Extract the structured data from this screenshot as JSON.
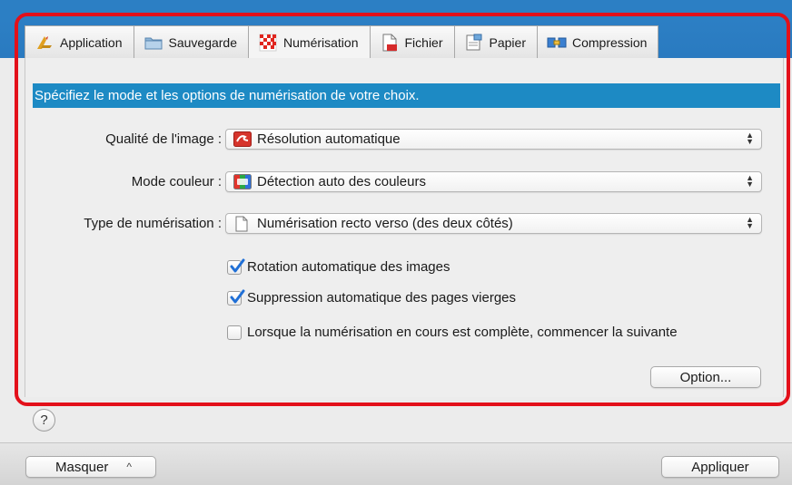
{
  "tabs": [
    {
      "label": "Application",
      "icon": "application-icon",
      "active": false
    },
    {
      "label": "Sauvegarde",
      "icon": "folder-icon",
      "active": false
    },
    {
      "label": "Numérisation",
      "icon": "scan-icon",
      "active": true
    },
    {
      "label": "Fichier",
      "icon": "file-icon",
      "active": false
    },
    {
      "label": "Papier",
      "icon": "paper-icon",
      "active": false
    },
    {
      "label": "Compression",
      "icon": "compression-icon",
      "active": false
    }
  ],
  "banner": "Spécifiez le mode et les options de numérisation de votre choix.",
  "fields": {
    "quality_label": "Qualité de l'image :",
    "quality_value": "Résolution automatique",
    "color_label": "Mode couleur :",
    "color_value": "Détection auto des couleurs",
    "scan_type_label": "Type de numérisation :",
    "scan_type_value": "Numérisation recto verso (des deux côtés)"
  },
  "checkboxes": [
    {
      "label": "Rotation automatique des images",
      "checked": true
    },
    {
      "label": "Suppression automatique des pages vierges",
      "checked": true
    },
    {
      "label": "Lorsque la numérisation en cours est complète, commencer la suivante",
      "checked": false
    }
  ],
  "buttons": {
    "option": "Option...",
    "hide": "Masquer",
    "hide_chevron": "^",
    "apply": "Appliquer",
    "help": "?"
  },
  "colors": {
    "banner_bg": "#1d8ac4",
    "highlight_outline": "#e3101a",
    "checkbox_check": "#1f6fd6"
  }
}
